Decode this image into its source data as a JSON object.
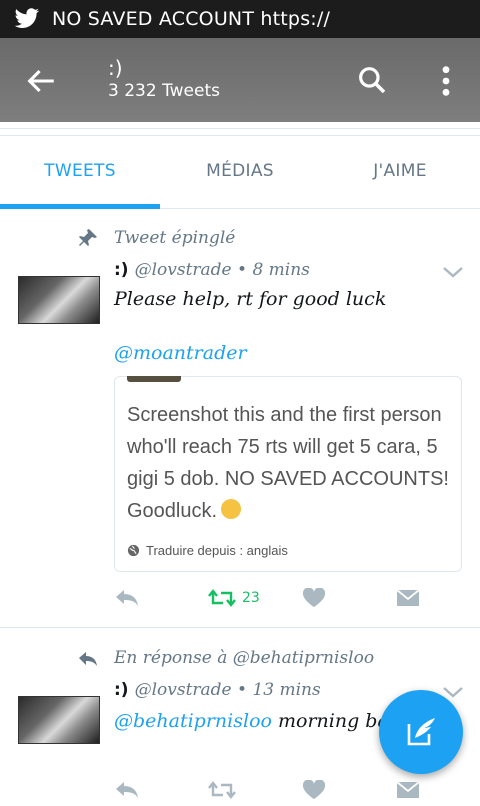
{
  "statusbar": {
    "text": "NO SAVED ACCOUNT https://",
    "icon": "twitter-bird-icon"
  },
  "appbar": {
    "title": ":)",
    "subtitle": "3 232 Tweets"
  },
  "tabs": [
    {
      "label": "TWEETS",
      "active": true
    },
    {
      "label": "MÉDIAS",
      "active": false
    },
    {
      "label": "J'AIME",
      "active": false
    }
  ],
  "tweet1": {
    "context": "Tweet épinglé",
    "name": ":)",
    "handle_time": "@lovstrade • 8 mins",
    "text": "Please help, rt for good luck",
    "mention": "@moantrader",
    "card": {
      "text": "Screenshot this and the first person who'll reach 75 rts will get 5 cara, 5 gigi  5 dob. NO SAVED ACCOUNTS! Goodluck.",
      "translate": "Traduire depuis : anglais"
    },
    "retweets": "23"
  },
  "tweet2": {
    "context": "En réponse à @behatiprnisloo",
    "name": ":)",
    "handle_time": "@lovstrade • 13 mins",
    "mention": "@behatiprnisloo",
    "text": " morning ba"
  },
  "colors": {
    "accent": "#1da1f2",
    "retweet": "#17bf63",
    "appbar": "#747474"
  }
}
